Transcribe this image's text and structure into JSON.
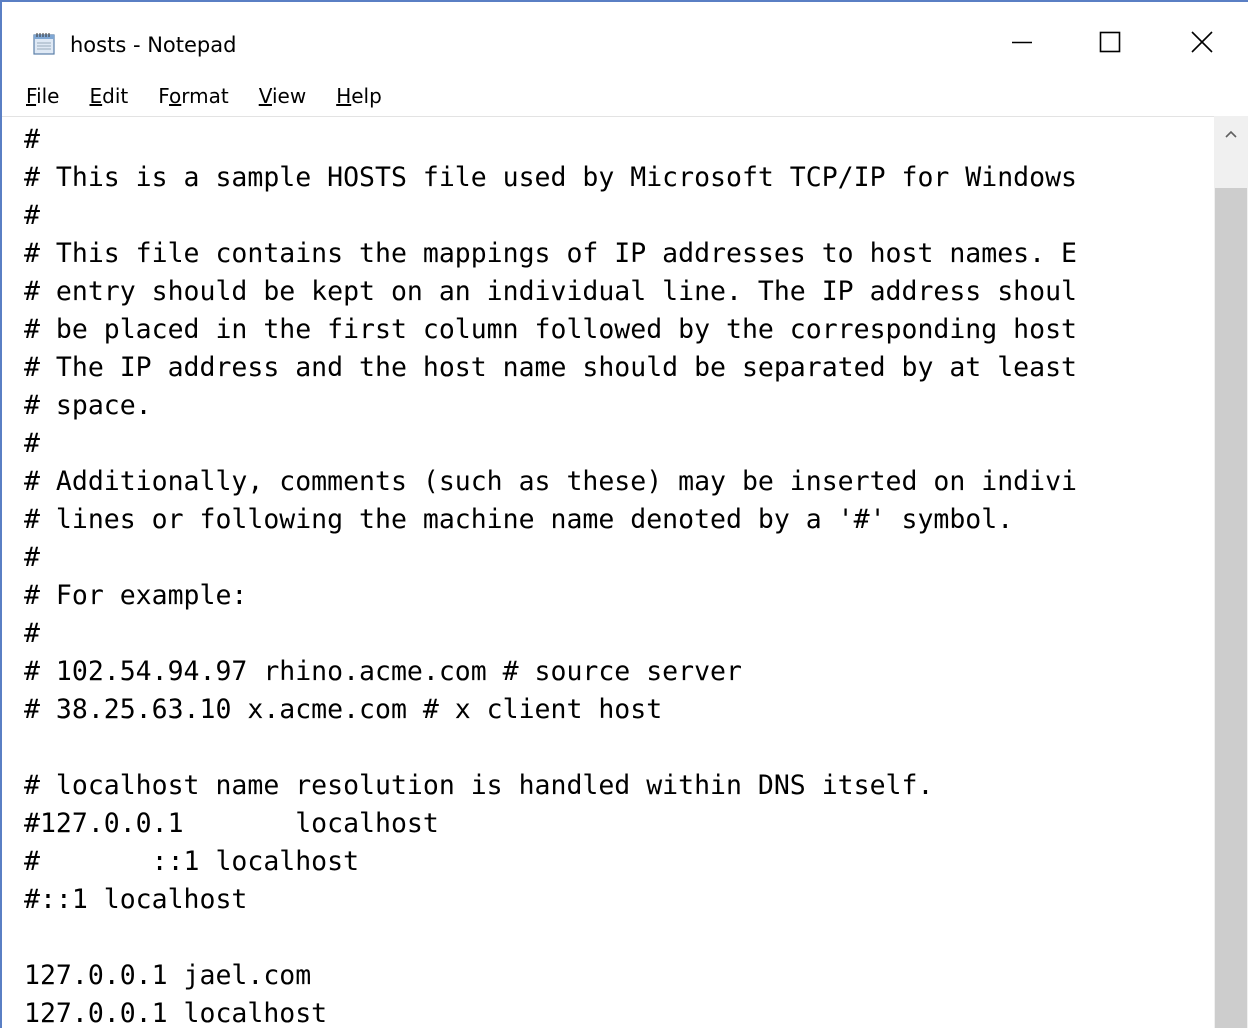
{
  "window": {
    "title": "hosts - Notepad"
  },
  "menu": [
    {
      "label_pre": "",
      "accel": "F",
      "label_post": "ile"
    },
    {
      "label_pre": "",
      "accel": "E",
      "label_post": "dit"
    },
    {
      "label_pre": "F",
      "accel": "o",
      "label_post": "rmat"
    },
    {
      "label_pre": "",
      "accel": "V",
      "label_post": "iew"
    },
    {
      "label_pre": "",
      "accel": "H",
      "label_post": "elp"
    }
  ],
  "editor": {
    "text": "#\n# This is a sample HOSTS file used by Microsoft TCP/IP for Windows\n#\n# This file contains the mappings of IP addresses to host names. E\n# entry should be kept on an individual line. The IP address shoul\n# be placed in the first column followed by the corresponding host\n# The IP address and the host name should be separated by at least\n# space.\n#\n# Additionally, comments (such as these) may be inserted on indivi\n# lines or following the machine name denoted by a '#' symbol.\n#\n# For example:\n#\n# 102.54.94.97 rhino.acme.com # source server\n# 38.25.63.10 x.acme.com # x client host\n\n# localhost name resolution is handled within DNS itself.\n#127.0.0.1       localhost\n#       ::1 localhost\n#::1 localhost\n\n127.0.0.1 jael.com\n127.0.0.1 localhost"
  },
  "icons": {
    "app": "notepad-icon",
    "minimize": "minimize-icon",
    "maximize": "maximize-icon",
    "close": "close-icon",
    "scroll_up": "chevron-up-icon"
  }
}
